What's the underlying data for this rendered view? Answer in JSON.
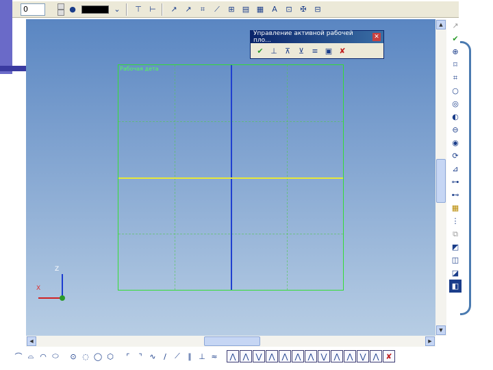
{
  "toolbar": {
    "layer_value": "0",
    "icons": [
      "arrow-icon",
      "line-style-icon",
      "filter-icon",
      "select-filter-icon",
      "select-arrow-icon",
      "move-icon",
      "snap-icon",
      "measure-icon",
      "dimension-icon",
      "hatch-icon",
      "table-icon",
      "text-icon",
      "text-frame-icon",
      "symbols-icon",
      "label-icon"
    ]
  },
  "panel": {
    "title": "Управление активной рабочей пло...",
    "close_glyph": "✕",
    "icons": [
      "apply-icon",
      "plane-icon",
      "plane-offset-icon",
      "plane-rotate-icon",
      "plane-list-icon",
      "grid-icon",
      "delete-icon"
    ]
  },
  "viewport": {
    "frame_label": "Рабочая дета",
    "triad_z": "Z",
    "triad_x": "X"
  },
  "right_toolbar": {
    "icons": [
      "cursor-icon",
      "check-icon",
      "zoom-in-icon",
      "zoom-window-icon",
      "zoom-fit-icon",
      "zoom-icon",
      "zoom-extents-icon",
      "zoom-previous-icon",
      "zoom-out-icon",
      "zoom-realtime-icon",
      "rotate-icon",
      "view-icon",
      "section-icon",
      "mirror-icon",
      "dimension-icon",
      "constraint-icon",
      "layers-icon",
      "render-icon",
      "solid-icon",
      "shaded-icon",
      "wireframe-icon"
    ]
  },
  "bottom_toolbar": {
    "icons": [
      "arc-icon",
      "arc-3pt-icon",
      "arc-tangent-icon",
      "ellipse-icon",
      "circle-center-icon",
      "circle-tangent-icon",
      "circle-3pt-icon",
      "polygon-icon",
      "fillet-icon",
      "chamfer-icon",
      "spline-icon",
      "line-icon",
      "line-tangent-icon",
      "line-parallel-icon",
      "line-perp-icon",
      "offset-icon",
      "trim-icon",
      "extend-icon",
      "break-icon",
      "copy-icon",
      "mirror-icon",
      "rotate-icon",
      "scale-icon",
      "array-icon",
      "stretch-icon",
      "align-icon",
      "distribute-icon",
      "explode-icon",
      "close-icon"
    ]
  },
  "colors": {
    "viewport_top": "#5a86c2",
    "viewport_bottom": "#b7cde4",
    "frame": "#33dd33",
    "axis_vertical": "#1f3fd0",
    "axis_horizontal": "#e8e838"
  }
}
